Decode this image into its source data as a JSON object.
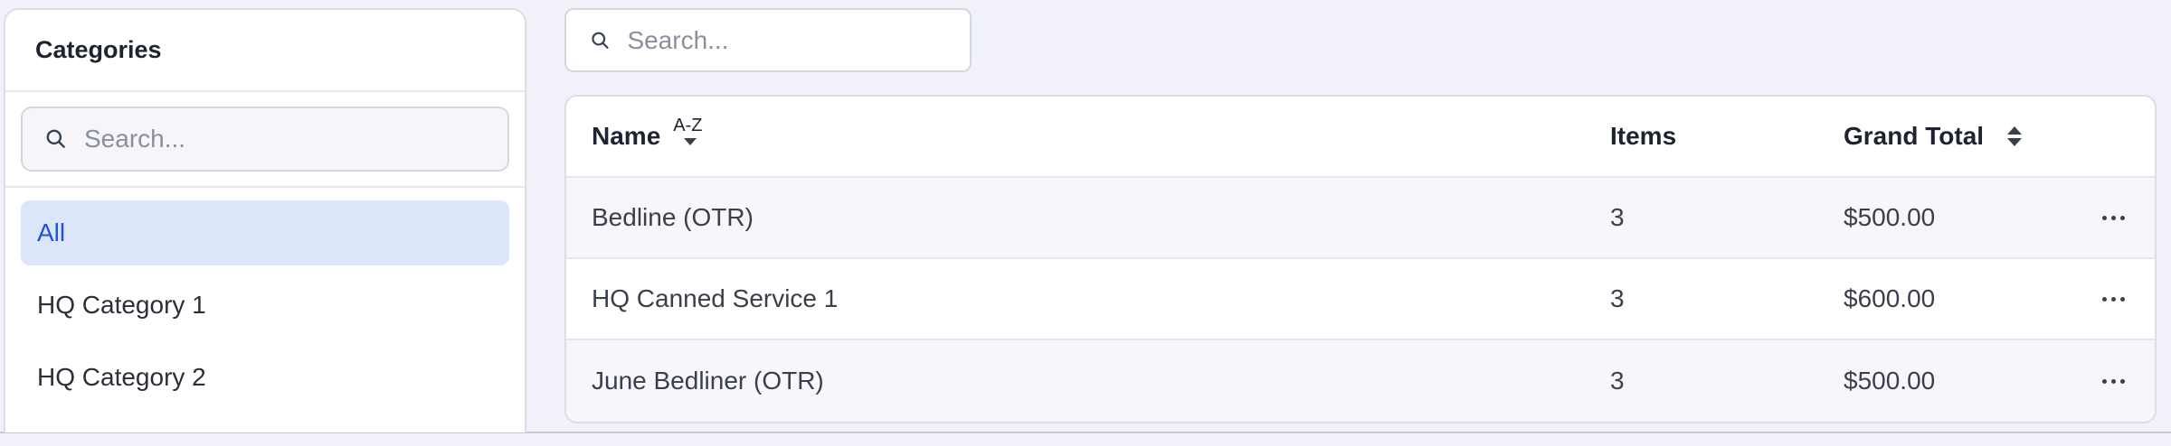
{
  "sidebar": {
    "title": "Categories",
    "search_placeholder": "Search...",
    "items": [
      {
        "label": "All",
        "active": true
      },
      {
        "label": "HQ Category 1",
        "active": false
      },
      {
        "label": "HQ Category 2",
        "active": false
      }
    ]
  },
  "main": {
    "search_placeholder": "Search...",
    "table": {
      "columns": {
        "name": "Name",
        "name_sort": "A-Z",
        "items": "Items",
        "grand_total": "Grand Total"
      },
      "rows": [
        {
          "name": "Bedline (OTR)",
          "items": "3",
          "grand_total": "$500.00"
        },
        {
          "name": "HQ Canned Service 1",
          "items": "3",
          "grand_total": "$600.00"
        },
        {
          "name": "June Bedliner (OTR)",
          "items": "3",
          "grand_total": "$500.00"
        }
      ]
    }
  },
  "colors": {
    "page_bg": "#f1f1f9",
    "active_bg": "#dbe6fb",
    "active_text": "#2452d6"
  },
  "icons": [
    "search-icon",
    "sort-ascending-icon",
    "sort-both-icon",
    "more-icon"
  ]
}
